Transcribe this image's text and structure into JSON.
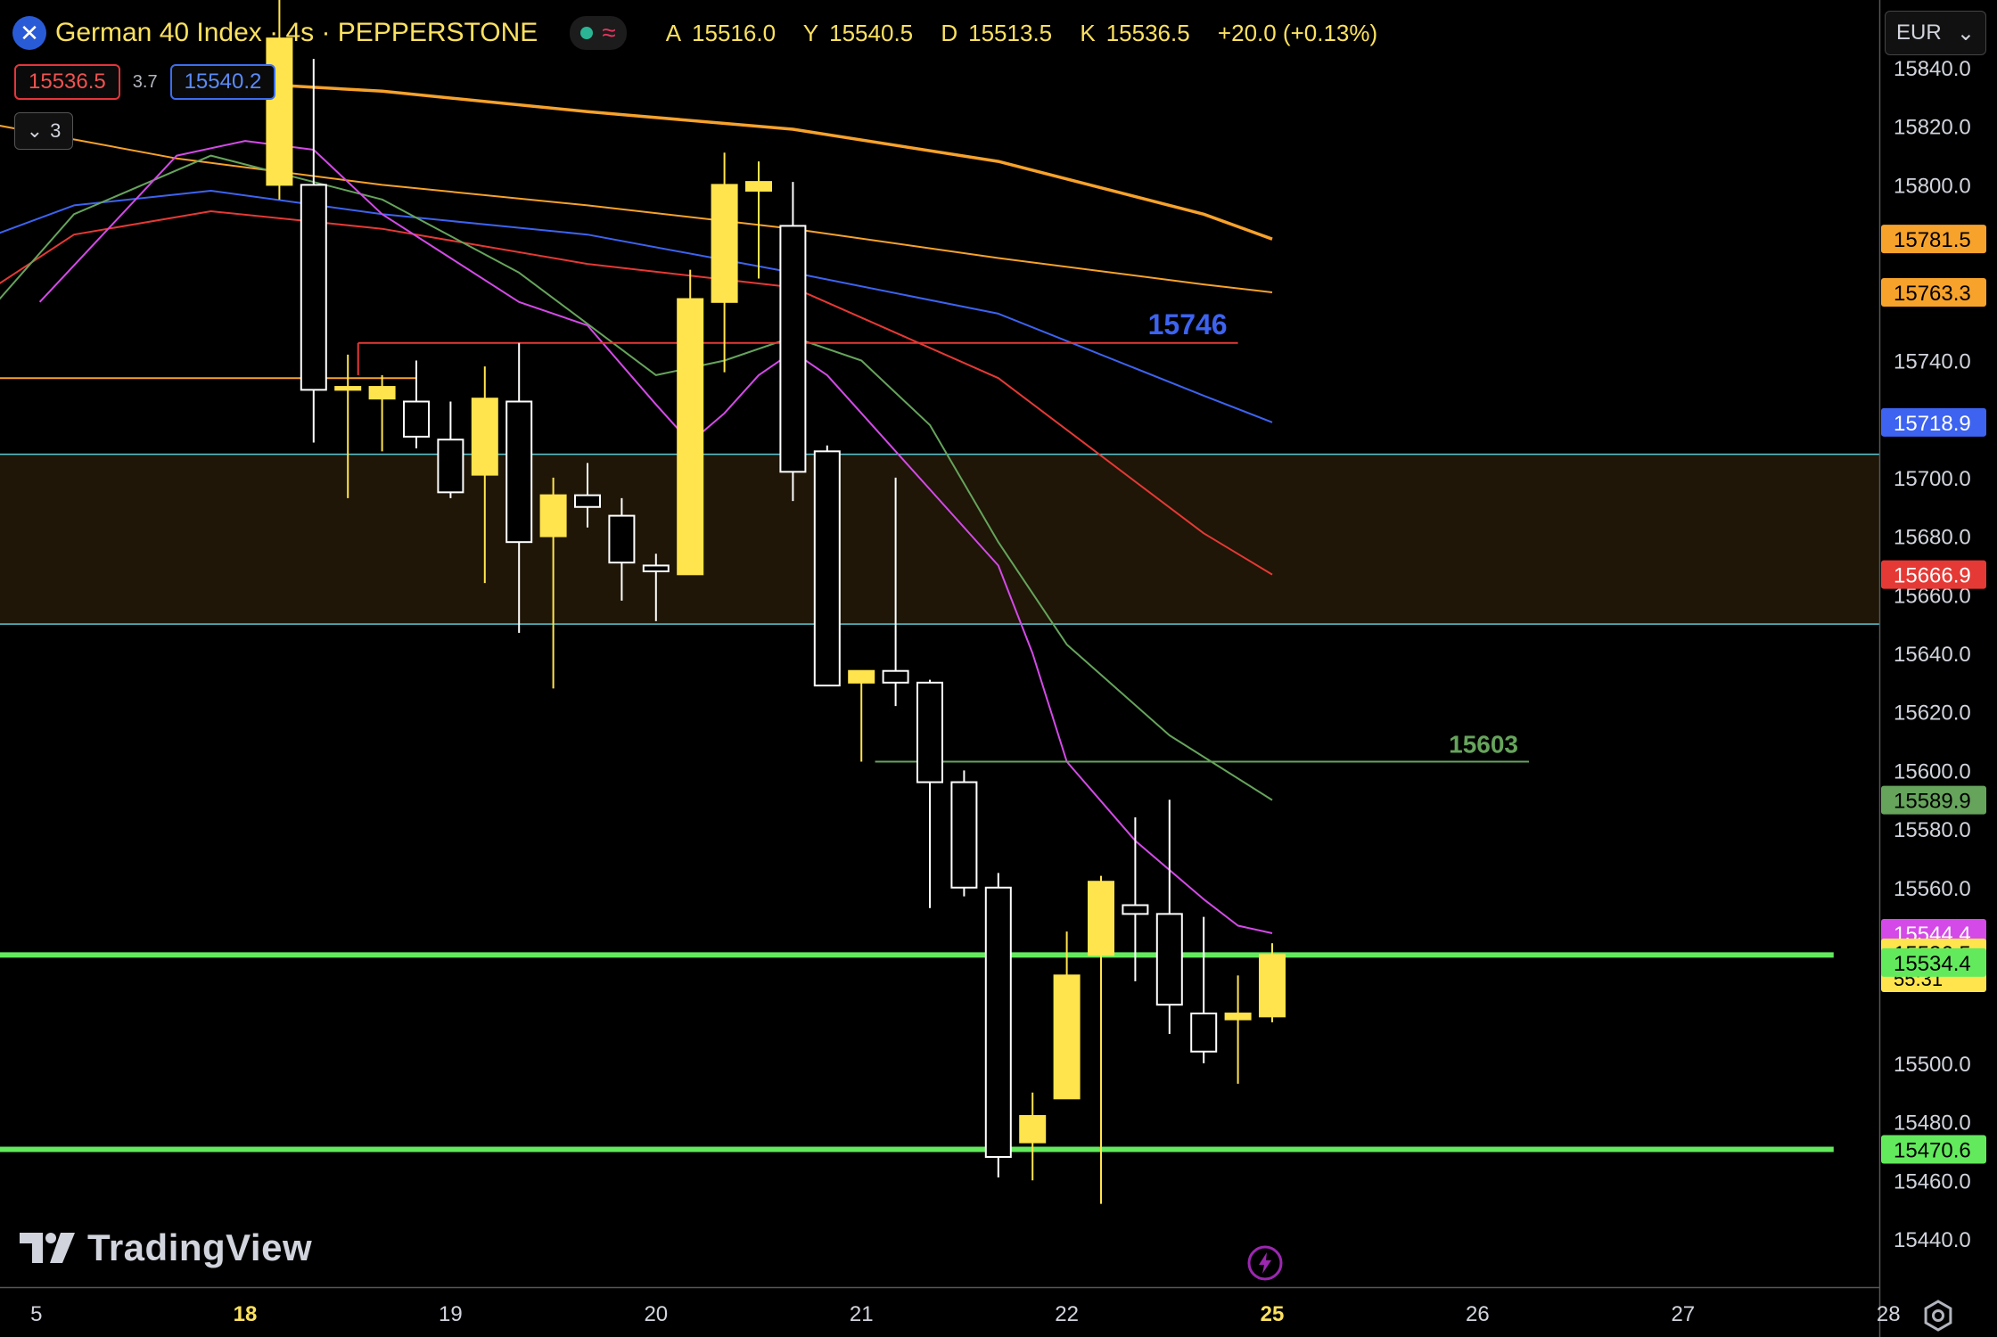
{
  "header": {
    "title": "German 40 Index · 4s · PEPPERSTONE",
    "ohlc": [
      {
        "label": "A",
        "value": "15516.0"
      },
      {
        "label": "Y",
        "value": "15540.5"
      },
      {
        "label": "D",
        "value": "15513.5"
      },
      {
        "label": "K",
        "value": "15536.5"
      },
      {
        "label": "",
        "value": "+20.0 (+0.13%)"
      }
    ]
  },
  "trade": {
    "sell": "15536.5",
    "spread": "3.7",
    "buy": "15540.2"
  },
  "indicators_collapse": {
    "count": "3"
  },
  "currency": "EUR",
  "branding": {
    "logo_text": "TradingView"
  },
  "colors": {
    "up": "#ffe44d",
    "down": "#000000",
    "wick": "#ffffff",
    "ma_orange": "#f7a22b",
    "ma_blue": "#3d63f0",
    "ma_red": "#e53935",
    "ma_green": "#66a45c",
    "ma_magenta": "#d44ae8",
    "support": "#62ea5c",
    "zone": "#1f1607",
    "zone_line": "#5ec9d6"
  },
  "chart_data": {
    "type": "candlestick",
    "y_range": [
      15430,
      15845
    ],
    "x_labels": [
      {
        "i": -7.1,
        "label": "5",
        "bold": false
      },
      {
        "i": -1.0,
        "label": "18",
        "bold": true
      },
      {
        "i": 5.0,
        "label": "19",
        "bold": false
      },
      {
        "i": 11.0,
        "label": "20",
        "bold": false
      },
      {
        "i": 17.0,
        "label": "21",
        "bold": false
      },
      {
        "i": 23.0,
        "label": "22",
        "bold": false
      },
      {
        "i": 29.0,
        "label": "25",
        "bold": true
      },
      {
        "i": 35.0,
        "label": "26",
        "bold": false
      },
      {
        "i": 41.0,
        "label": "27",
        "bold": false
      },
      {
        "i": 47.0,
        "label": "28",
        "bold": false
      }
    ],
    "y_ticks": [
      "15840.0",
      "15820.0",
      "15800.0",
      "15740.0",
      "15700.0",
      "15680.0",
      "15660.0",
      "15640.0",
      "15620.0",
      "15600.0",
      "15580.0",
      "15560.0",
      "15500.0",
      "15480.0",
      "15460.0",
      "15440.0"
    ],
    "candles": [
      {
        "o": 15800,
        "h": 15880,
        "l": 15795,
        "c": 15850
      },
      {
        "o": 15800,
        "h": 15843,
        "l": 15712,
        "c": 15730
      },
      {
        "o": 15730,
        "h": 15742,
        "l": 15693,
        "c": 15731
      },
      {
        "o": 15727,
        "h": 15735,
        "l": 15709,
        "c": 15731
      },
      {
        "o": 15726,
        "h": 15740,
        "l": 15710,
        "c": 15714
      },
      {
        "o": 15713,
        "h": 15726,
        "l": 15693,
        "c": 15695
      },
      {
        "o": 15701,
        "h": 15738,
        "l": 15664,
        "c": 15727
      },
      {
        "o": 15726,
        "h": 15746,
        "l": 15647,
        "c": 15678
      },
      {
        "o": 15680,
        "h": 15700,
        "l": 15628,
        "c": 15694
      },
      {
        "o": 15694,
        "h": 15705,
        "l": 15683,
        "c": 15690
      },
      {
        "o": 15687,
        "h": 15693,
        "l": 15658,
        "c": 15671
      },
      {
        "o": 15670,
        "h": 15674,
        "l": 15651,
        "c": 15668
      },
      {
        "o": 15667,
        "h": 15771,
        "l": 15667,
        "c": 15761
      },
      {
        "o": 15760,
        "h": 15811,
        "l": 15736,
        "c": 15800
      },
      {
        "o": 15798,
        "h": 15808,
        "l": 15768,
        "c": 15801
      },
      {
        "o": 15786,
        "h": 15801,
        "l": 15692,
        "c": 15702
      },
      {
        "o": 15709,
        "h": 15711,
        "l": 15629,
        "c": 15629
      },
      {
        "o": 15630,
        "h": 15631,
        "l": 15603,
        "c": 15634
      },
      {
        "o": 15634,
        "h": 15700,
        "l": 15622,
        "c": 15630
      },
      {
        "o": 15630,
        "h": 15631,
        "l": 15553,
        "c": 15596
      },
      {
        "o": 15596,
        "h": 15600,
        "l": 15557,
        "c": 15560
      },
      {
        "o": 15560,
        "h": 15565,
        "l": 15461,
        "c": 15468
      },
      {
        "o": 15473,
        "h": 15490,
        "l": 15460,
        "c": 15482
      },
      {
        "o": 15488,
        "h": 15545,
        "l": 15488,
        "c": 15530
      },
      {
        "o": 15537,
        "h": 15564,
        "l": 15452,
        "c": 15562
      },
      {
        "o": 15554,
        "h": 15584,
        "l": 15528,
        "c": 15551
      },
      {
        "o": 15551,
        "h": 15590,
        "l": 15510,
        "c": 15520
      },
      {
        "o": 15517,
        "h": 15550,
        "l": 15500,
        "c": 15504
      },
      {
        "o": 15515,
        "h": 15530,
        "l": 15493,
        "c": 15517
      },
      {
        "o": 15516,
        "h": 15541,
        "l": 15514,
        "c": 15537
      }
    ],
    "moving_averages": [
      {
        "color_key": "ma_orange",
        "width": 3.5,
        "last": "15781.5",
        "points": [
          [
            -3,
            15836
          ],
          [
            3,
            15832
          ],
          [
            9,
            15825
          ],
          [
            15,
            15819
          ],
          [
            21,
            15808
          ],
          [
            27,
            15790
          ],
          [
            29,
            15781.5
          ]
        ]
      },
      {
        "color_key": "ma_orange",
        "width": 2,
        "last": "15763.3",
        "points": [
          [
            -9,
            15822
          ],
          [
            -3,
            15809
          ],
          [
            3,
            15800
          ],
          [
            9,
            15793
          ],
          [
            15,
            15785
          ],
          [
            21,
            15775
          ],
          [
            27,
            15766
          ],
          [
            29,
            15763.3
          ]
        ]
      },
      {
        "color_key": "ma_blue",
        "width": 2,
        "last": "15718.9",
        "points": [
          [
            -9,
            15780
          ],
          [
            -6,
            15793
          ],
          [
            -2,
            15798
          ],
          [
            3,
            15790
          ],
          [
            9,
            15783
          ],
          [
            15,
            15770
          ],
          [
            21,
            15756
          ],
          [
            27,
            15728
          ],
          [
            29,
            15718.9
          ]
        ]
      },
      {
        "color_key": "ma_red",
        "width": 2,
        "last": "15666.9",
        "points": [
          [
            -9,
            15760
          ],
          [
            -6,
            15783
          ],
          [
            -2,
            15791
          ],
          [
            3,
            15785
          ],
          [
            9,
            15773
          ],
          [
            15,
            15765
          ],
          [
            21,
            15734
          ],
          [
            27,
            15681
          ],
          [
            29,
            15666.9
          ]
        ]
      },
      {
        "color_key": "ma_green",
        "width": 2,
        "last": "15589.9",
        "points": [
          [
            -9,
            15750
          ],
          [
            -6,
            15790
          ],
          [
            -2,
            15810
          ],
          [
            3,
            15795
          ],
          [
            7,
            15770
          ],
          [
            11,
            15735
          ],
          [
            13,
            15740
          ],
          [
            15,
            15748
          ],
          [
            17,
            15740
          ],
          [
            19,
            15718
          ],
          [
            21,
            15678
          ],
          [
            23,
            15643
          ],
          [
            26,
            15612
          ],
          [
            29,
            15589.9
          ]
        ]
      },
      {
        "color_key": "ma_magenta",
        "width": 2,
        "last": "15544.4",
        "points": [
          [
            -7,
            15760
          ],
          [
            -3,
            15810
          ],
          [
            -1,
            15815
          ],
          [
            1,
            15812
          ],
          [
            3,
            15790
          ],
          [
            5,
            15775
          ],
          [
            7,
            15760
          ],
          [
            9,
            15752
          ],
          [
            11,
            15725
          ],
          [
            12,
            15712
          ],
          [
            13,
            15722
          ],
          [
            14,
            15735
          ],
          [
            15,
            15743
          ],
          [
            16,
            15735
          ],
          [
            17,
            15722
          ],
          [
            19,
            15696
          ],
          [
            21,
            15670
          ],
          [
            22,
            15640
          ],
          [
            23,
            15603
          ],
          [
            25,
            15576
          ],
          [
            27,
            15556
          ],
          [
            28,
            15547
          ],
          [
            29,
            15544.4
          ]
        ]
      }
    ],
    "levels": [
      {
        "name": "resistance-15746",
        "price": 15746,
        "from": 2.3,
        "to": 28,
        "color_key": "ma_red",
        "label": "15746",
        "label_color_key": "ma_blue"
      },
      {
        "name": "level-15603",
        "price": 15603,
        "from": 17.4,
        "to": 36.5,
        "color_key": "ma_green",
        "label": "15603",
        "label_color_key": "ma_green"
      },
      {
        "name": "short-orange-level",
        "price": 15734,
        "from": -9,
        "to": 4,
        "color_key": "ma_orange"
      },
      {
        "name": "support-15536",
        "price": 15537,
        "from": -9,
        "to": 45.4,
        "color_key": "support",
        "width": 6
      },
      {
        "name": "support-15470",
        "price": 15470.6,
        "from": -9,
        "to": 45.4,
        "color_key": "support",
        "width": 6
      }
    ],
    "zone": {
      "top": 15708,
      "bottom": 15650
    },
    "price_labels": [
      {
        "value": "15781.5",
        "price": 15781.5,
        "bg": "#f7a22b",
        "fg": "#000000"
      },
      {
        "value": "15763.3",
        "price": 15763.3,
        "bg": "#f7a22b",
        "fg": "#000000"
      },
      {
        "value": "15718.9",
        "price": 15718.9,
        "bg": "#3d63f0",
        "fg": "#ffffff"
      },
      {
        "value": "15666.9",
        "price": 15666.9,
        "bg": "#e53935",
        "fg": "#ffffff"
      },
      {
        "value": "15589.9",
        "price": 15589.9,
        "bg": "#66a45c",
        "fg": "#000000"
      },
      {
        "value": "15544.4",
        "price": 15544.4,
        "bg": "#d44ae8",
        "fg": "#ffffff"
      },
      {
        "value": "15536.5",
        "sub": "55:31",
        "price": 15536.5,
        "bg": "#ffe44d",
        "fg": "#000000"
      },
      {
        "value": "15534.4",
        "price": 15534.4,
        "bg": "#62ea5c",
        "fg": "#000000"
      },
      {
        "value": "15470.6",
        "price": 15470.6,
        "bg": "#62ea5c",
        "fg": "#000000"
      }
    ]
  }
}
